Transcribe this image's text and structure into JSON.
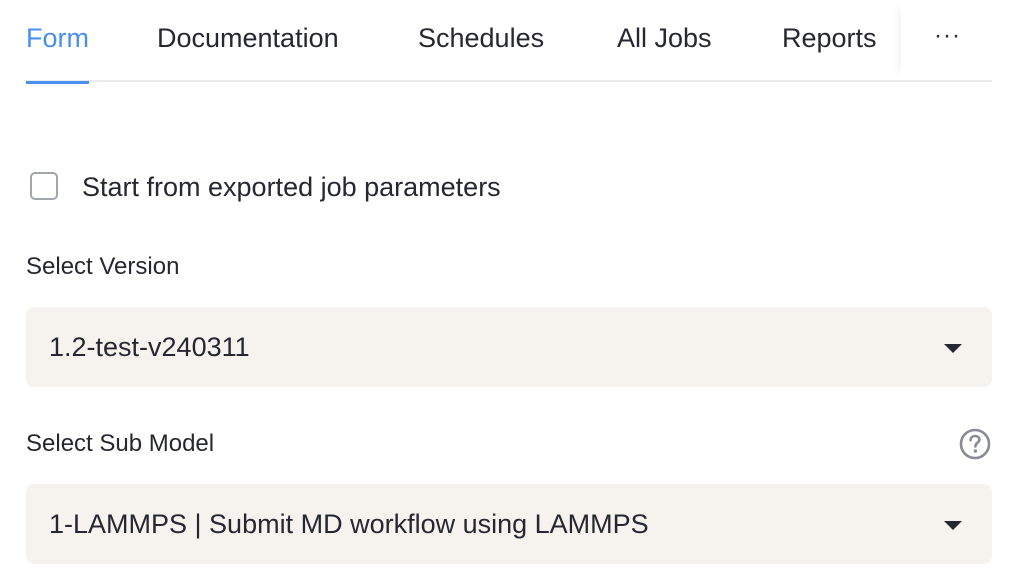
{
  "tabs": {
    "items": [
      {
        "label": "Form",
        "active": true
      },
      {
        "label": "Documentation",
        "active": false
      },
      {
        "label": "Schedules",
        "active": false
      },
      {
        "label": "All Jobs",
        "active": false
      },
      {
        "label": "Reports",
        "active": false
      }
    ],
    "more_label": "···"
  },
  "checkbox": {
    "label": "Start from exported job parameters",
    "checked": false
  },
  "version": {
    "label": "Select Version",
    "value": "1.2-test-v240311"
  },
  "sub_model": {
    "label": "Select Sub Model",
    "value": "1-LAMMPS | Submit MD workflow using LAMMPS",
    "help_icon": "question-circle-icon"
  },
  "colors": {
    "accent": "#4a8ef0",
    "text": "#262730",
    "select_background": "#f6f3ee",
    "border": "#e9eaee"
  }
}
